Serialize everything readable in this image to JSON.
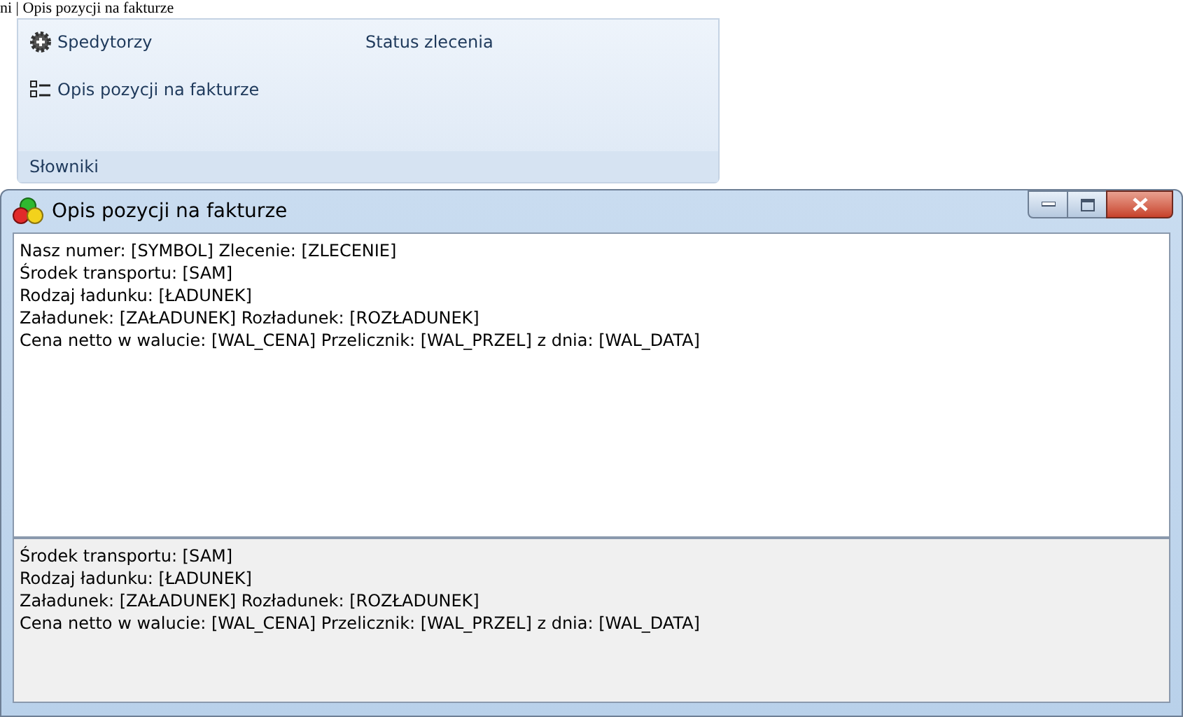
{
  "page_title": "ni | Opis pozycji na fakturze",
  "ribbon": {
    "items": [
      {
        "label": "Spedytorzy",
        "kind": "gear"
      },
      {
        "label": "Status zlecenia",
        "kind": "plain"
      },
      {
        "label": "Opis pozycji na fakturze",
        "kind": "list"
      }
    ],
    "group_label": "Słowniki"
  },
  "window": {
    "title": "Opis pozycji na fakturze",
    "editor_lines": [
      "Nasz numer: [SYMBOL] Zlecenie: [ZLECENIE]",
      "Środek transportu: [SAM]",
      "Rodzaj ładunku: [ŁADUNEK]",
      "Załadunek: [ZAŁADUNEK] Rozładunek: [ROZŁADUNEK]",
      "Cena netto w walucie: [WAL_CENA] Przelicznik: [WAL_PRZEL] z dnia: [WAL_DATA]"
    ],
    "preview_lines": [
      "Środek transportu: [SAM]",
      "Rodzaj ładunku: [ŁADUNEK]",
      "Załadunek: [ZAŁADUNEK] Rozładunek: [ROZŁADUNEK]",
      "Cena netto w walucie: [WAL_CENA] Przelicznik: [WAL_PRZEL] z dnia: [WAL_DATA]"
    ]
  }
}
